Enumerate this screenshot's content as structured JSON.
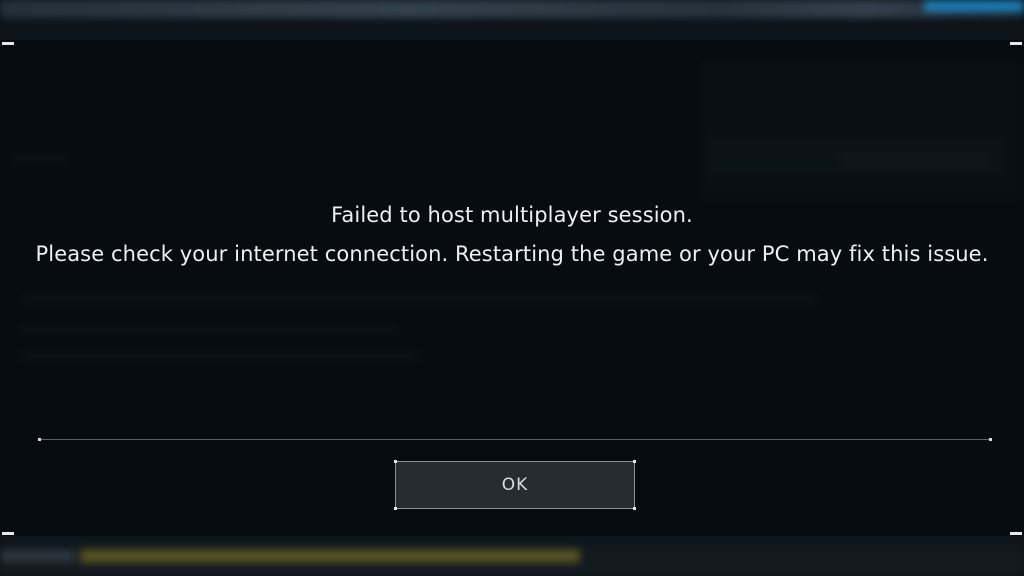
{
  "dialog": {
    "message_lines": [
      "Failed to host multiplayer session.",
      "Please check your internet connection. Restarting the game or your PC may fix this issue."
    ],
    "ok_label": "OK"
  },
  "colors": {
    "overlay": "#060a0e",
    "text": "#eef0f1",
    "button_border": "#aab4ba",
    "top_accent": "#1f8fd0"
  }
}
